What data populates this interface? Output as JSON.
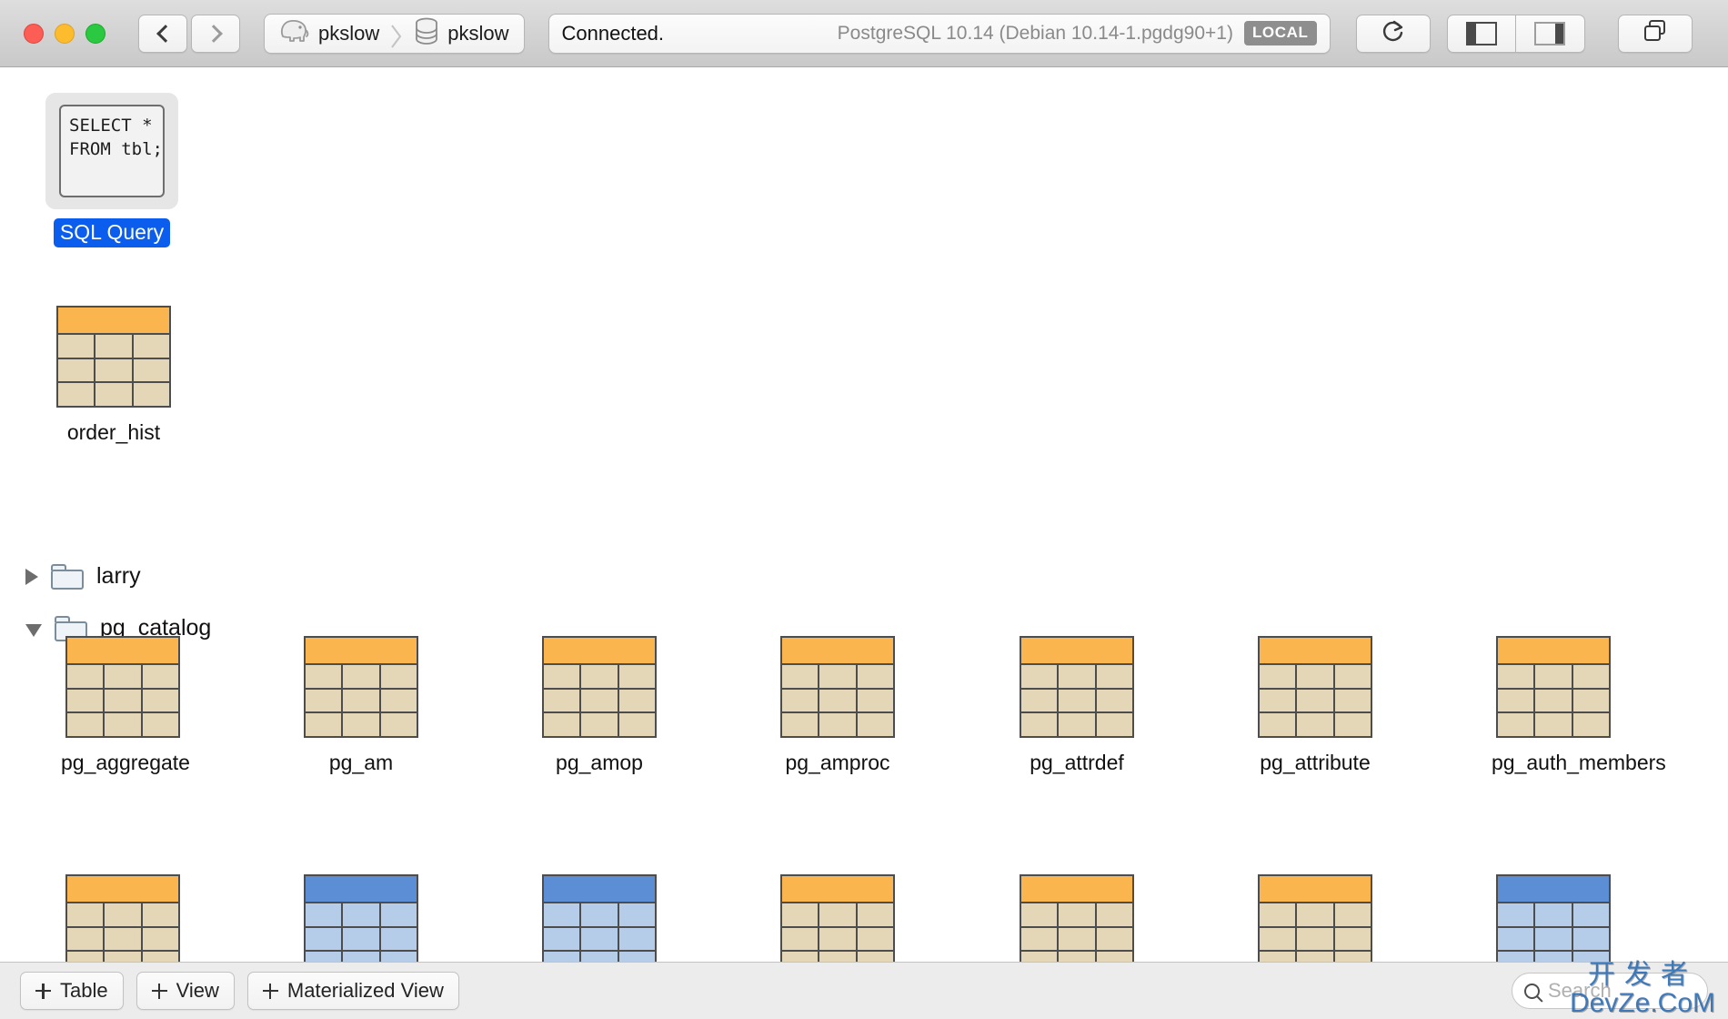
{
  "window": {
    "traffic_lights": [
      "close",
      "minimize",
      "zoom"
    ],
    "nav": {
      "back": "back",
      "forward": "forward"
    },
    "breadcrumb": [
      {
        "icon": "elephant-icon",
        "label": "pkslow"
      },
      {
        "icon": "database-icon",
        "label": "pkslow"
      }
    ],
    "status": {
      "connection": "Connected.",
      "version": "PostgreSQL 10.14 (Debian 10.14-1.pgdg90+1)",
      "badge": "LOCAL"
    },
    "actions": {
      "refresh": "refresh-icon",
      "left_panel": "left-sidebar-toggle",
      "right_panel": "right-sidebar-toggle",
      "windows": "windows-icon"
    }
  },
  "content": {
    "query_item": {
      "label": "SQL Query",
      "selected": true,
      "code_lines": [
        "SELECT *",
        "FROM tbl;"
      ]
    },
    "standalone_tables": [
      {
        "label": "order_hist",
        "kind": "table"
      }
    ],
    "schemas": [
      {
        "label": "larry",
        "expanded": false,
        "items": []
      },
      {
        "label": "pg_catalog",
        "expanded": true,
        "items": [
          {
            "label": "pg_aggregate",
            "kind": "table"
          },
          {
            "label": "pg_am",
            "kind": "table"
          },
          {
            "label": "pg_amop",
            "kind": "table"
          },
          {
            "label": "pg_amproc",
            "kind": "table"
          },
          {
            "label": "pg_attrdef",
            "kind": "table"
          },
          {
            "label": "pg_attribute",
            "kind": "table"
          },
          {
            "label": "pg_auth_members",
            "kind": "table"
          },
          {
            "label": "",
            "kind": "table"
          },
          {
            "label": "",
            "kind": "view"
          },
          {
            "label": "",
            "kind": "view"
          },
          {
            "label": "",
            "kind": "table"
          },
          {
            "label": "",
            "kind": "table"
          },
          {
            "label": "",
            "kind": "table"
          },
          {
            "label": "",
            "kind": "view"
          }
        ]
      }
    ]
  },
  "bottom_bar": {
    "buttons": [
      {
        "label": "Table"
      },
      {
        "label": "View"
      },
      {
        "label": "Materialized View"
      }
    ],
    "search": {
      "placeholder": "Search",
      "value": ""
    }
  },
  "watermark": {
    "line1": "开发者",
    "line2": "DevZe.CoM"
  },
  "colors": {
    "selection_blue": "#0b5ded",
    "table_header": "#fbb54e",
    "table_cell": "#e3d7b7",
    "view_header": "#5b8ed4",
    "view_cell": "#b6cdea",
    "toolbar_bg": "#d3d3d3",
    "bottom_bar_bg": "#ececec"
  }
}
